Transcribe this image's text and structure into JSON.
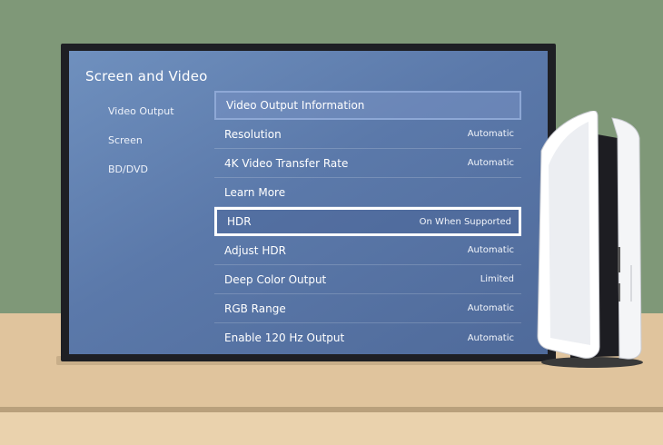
{
  "screen": {
    "title": "Screen and Video",
    "sidebar": [
      {
        "label": "Video Output"
      },
      {
        "label": "Screen"
      },
      {
        "label": "BD/DVD"
      }
    ],
    "menu": [
      {
        "label": "Video Output Information",
        "value": ""
      },
      {
        "label": "Resolution",
        "value": "Automatic"
      },
      {
        "label": "4K Video Transfer Rate",
        "value": "Automatic"
      },
      {
        "label": "Learn More",
        "value": ""
      },
      {
        "label": "HDR",
        "value": "On When Supported"
      },
      {
        "label": "Adjust HDR",
        "value": "Automatic"
      },
      {
        "label": "Deep Color Output",
        "value": "Limited"
      },
      {
        "label": "RGB Range",
        "value": "Automatic"
      },
      {
        "label": "Enable 120 Hz Output",
        "value": "Automatic"
      }
    ]
  },
  "colors": {
    "wall": "#7f9878",
    "desk": "#e0c49d",
    "screen_bg": "#5b79aa",
    "tv_bezel": "#1e1f24",
    "focus_border": "#ffffff"
  },
  "icons": {
    "console": "game-console-icon"
  }
}
